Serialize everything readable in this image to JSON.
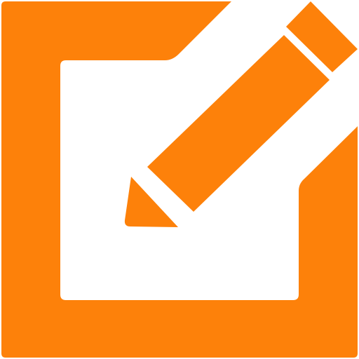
{
  "icon": {
    "name": "edit-icon",
    "description_semantic": "square-with-pencil",
    "color": "#FD810A",
    "background": "#FFFFFF"
  }
}
